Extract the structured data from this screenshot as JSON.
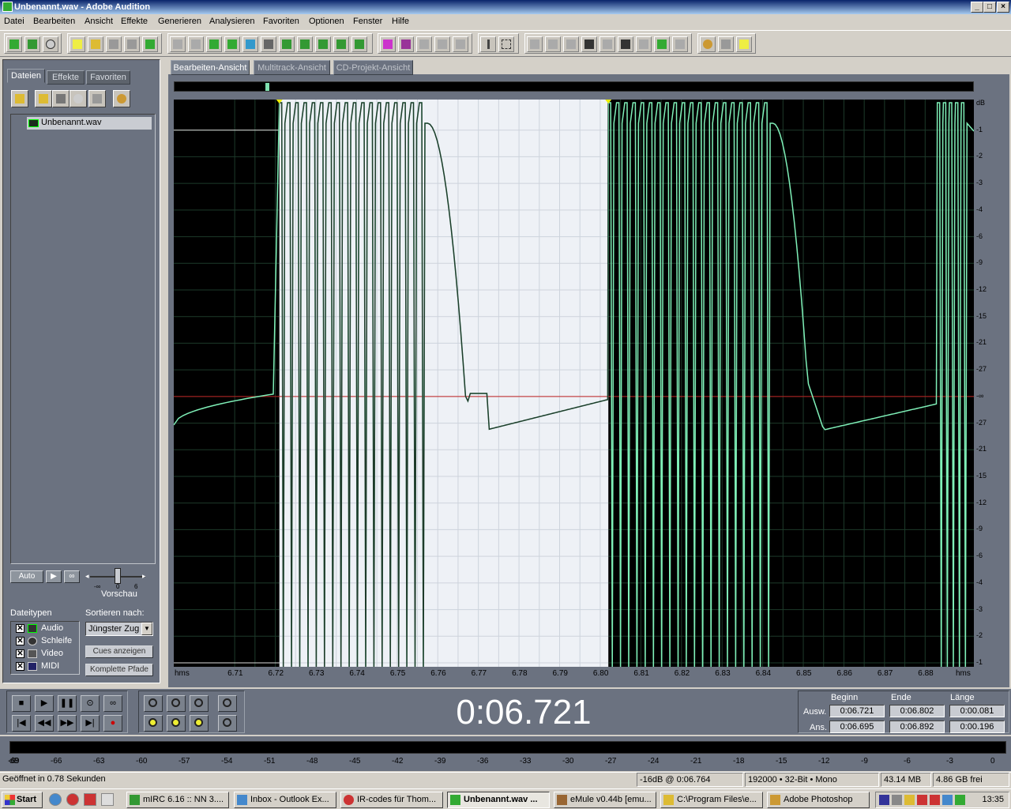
{
  "window": {
    "title": "Unbenannt.wav - Adobe Audition"
  },
  "menu": [
    "Datei",
    "Bearbeiten",
    "Ansicht",
    "Effekte",
    "Generieren",
    "Analysieren",
    "Favoriten",
    "Optionen",
    "Fenster",
    "Hilfe"
  ],
  "left_panel": {
    "tabs": [
      "Dateien",
      "Effekte",
      "Favoriten"
    ],
    "active_tab": "Dateien",
    "files": [
      "Unbenannt.wav"
    ],
    "auto_label": "Auto",
    "preview_label": "Vorschau",
    "volume_scale": [
      "-∞",
      "0",
      "6"
    ],
    "filetypes_label": "Dateitypen",
    "filetypes": [
      {
        "label": "Audio",
        "checked": true
      },
      {
        "label": "Schleife",
        "checked": true
      },
      {
        "label": "Video",
        "checked": true
      },
      {
        "label": "MIDI",
        "checked": true
      }
    ],
    "sort_label": "Sortieren nach:",
    "sort_value": "Jüngster Zug",
    "cues_button": "Cues anzeigen",
    "paths_button": "Komplette Pfade"
  },
  "editor": {
    "tabs": [
      "Bearbeiten-Ansicht",
      "Multitrack-Ansicht",
      "CD-Projekt-Ansicht"
    ],
    "active_tab": "Bearbeiten-Ansicht",
    "db_scale": [
      "dB",
      "-1",
      "-2",
      "-3",
      "-4",
      "-6",
      "-9",
      "-12",
      "-15",
      "-21",
      "-27",
      "-∞",
      "-27",
      "-21",
      "-15",
      "-12",
      "-9",
      "-6",
      "-4",
      "-3",
      "-2",
      "-1"
    ],
    "timeline_unit": "hms",
    "timeline": [
      "6.71",
      "6.72",
      "6.73",
      "6.74",
      "6.75",
      "6.76",
      "6.77",
      "6.78",
      "6.79",
      "6.80",
      "6.81",
      "6.82",
      "6.83",
      "6.84",
      "6.85",
      "6.86",
      "6.87",
      "6.88"
    ],
    "selection_start": 6.721,
    "selection_end": 6.802,
    "view_start": 6.695,
    "view_end": 6.892
  },
  "transport": {
    "timecode": "0:06.721",
    "headers": {
      "begin": "Beginn",
      "end": "Ende",
      "length": "Länge"
    },
    "rows": [
      {
        "label": "Ausw.",
        "begin": "0:06.721",
        "end": "0:06.802",
        "length": "0:00.081"
      },
      {
        "label": "Ans.",
        "begin": "0:06.695",
        "end": "0:06.892",
        "length": "0:00.196"
      }
    ]
  },
  "meter": {
    "labels": [
      "dB",
      "-69",
      "-66",
      "-63",
      "-60",
      "-57",
      "-54",
      "-51",
      "-48",
      "-45",
      "-42",
      "-39",
      "-36",
      "-33",
      "-30",
      "-27",
      "-24",
      "-21",
      "-18",
      "-15",
      "-12",
      "-9",
      "-6",
      "-3",
      "0"
    ]
  },
  "status": {
    "message": "Geöffnet in 0.78 Sekunden",
    "cursor": "-16dB @  0:06.764",
    "format": "192000 • 32-Bit • Mono",
    "size": "43.14 MB",
    "free": "4.86 GB frei"
  },
  "taskbar": {
    "start": "Start",
    "tasks": [
      {
        "label": "mIRC 6.16 :: NN 3....",
        "active": false
      },
      {
        "label": "Inbox - Outlook Ex...",
        "active": false
      },
      {
        "label": "IR-codes für Thom...",
        "active": false
      },
      {
        "label": "Unbenannt.wav ...",
        "active": true
      },
      {
        "label": "eMule v0.44b [emu...",
        "active": false
      },
      {
        "label": "C:\\Program Files\\e...",
        "active": false
      },
      {
        "label": "Adobe Photoshop",
        "active": false
      }
    ],
    "clock": "13:35"
  },
  "colors": {
    "wave_selected": "#1e3a2a",
    "wave": "#7ff0b8",
    "selection_bg": "#eef1f6",
    "zero_line": "#c02020",
    "panel": "#6b7280"
  }
}
